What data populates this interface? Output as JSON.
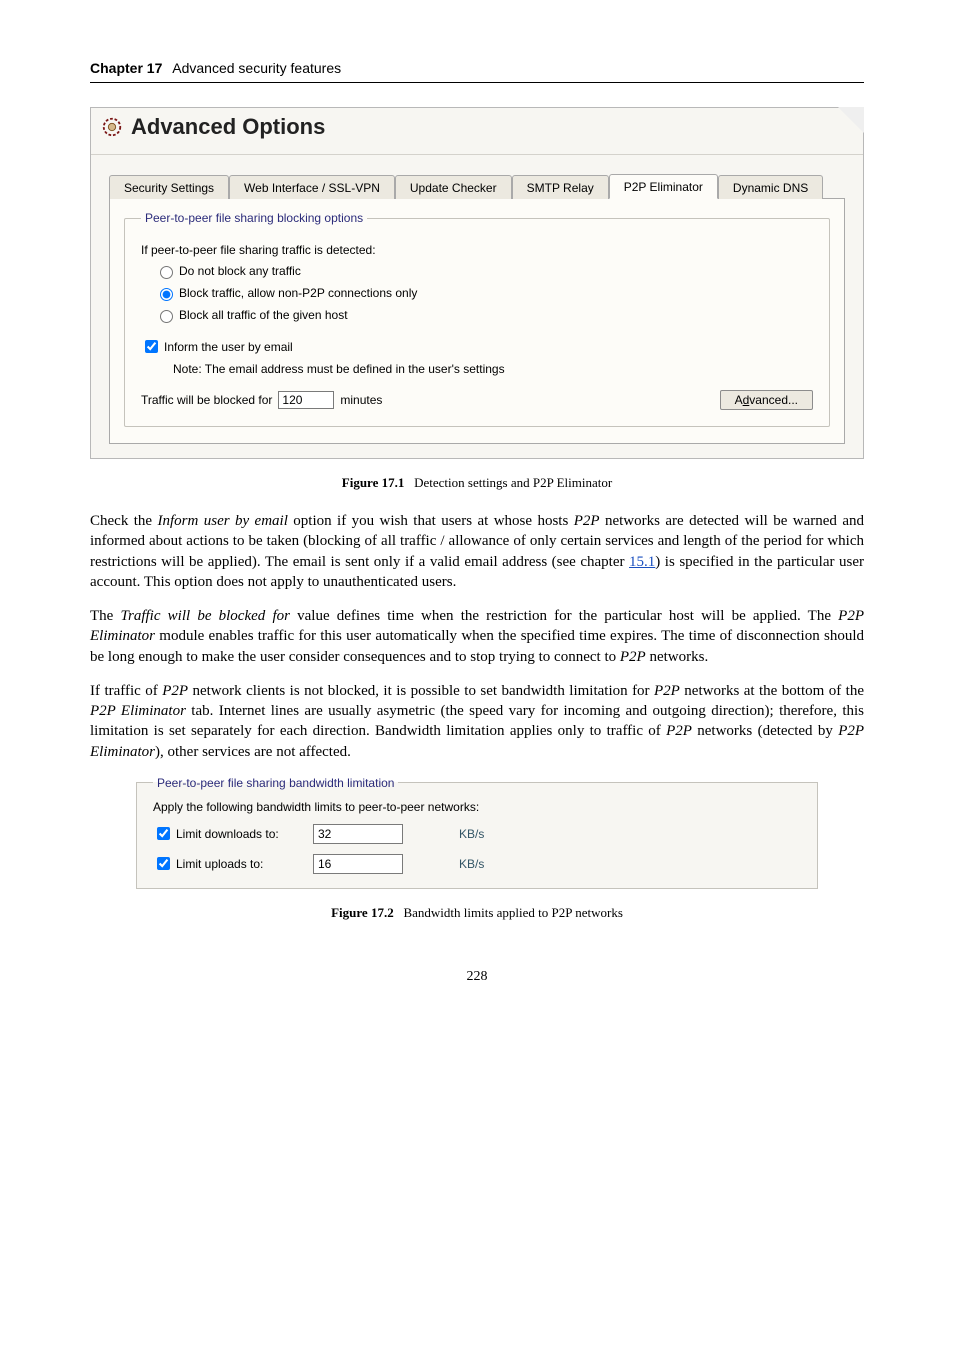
{
  "chapter": {
    "label": "Chapter 17",
    "title": "Advanced security features"
  },
  "panel": {
    "title": "Advanced Options",
    "tabs": {
      "security": "Security Settings",
      "web": "Web Interface / SSL-VPN",
      "update": "Update Checker",
      "smtp": "SMTP Relay",
      "p2p": "P2P Eliminator",
      "dns": "Dynamic DNS"
    },
    "group_legend": "Peer-to-peer file sharing blocking options",
    "detect_intro": "If peer-to-peer file sharing traffic is detected:",
    "opt_noblock": "Do not block any traffic",
    "opt_blocknonp2p": "Block traffic, allow non-P2P connections only",
    "opt_blockall": "Block all traffic of the given host",
    "inform_label": "Inform the user by email",
    "inform_note": "Note: The email address must be defined in the user's settings",
    "traffic_label_pre": "Traffic will be blocked for",
    "traffic_value": "120",
    "traffic_label_post": "minutes",
    "advanced_btn_pre": "A",
    "advanced_btn_accel": "d",
    "advanced_btn_post": "vanced..."
  },
  "fig1": {
    "label": "Figure 17.1",
    "caption": "Detection settings and P2P Eliminator"
  },
  "para1_a": "Check the ",
  "para1_em1": "Inform user by email",
  "para1_b": " option if you wish that users at whose hosts ",
  "para1_em2": "P2P",
  "para1_c": " networks are detected will be warned and informed about actions to be taken (blocking of all traffic / allowance of only certain services and length of the period for which restrictions will be applied). The email is sent only if a valid email address (see chapter ",
  "para1_link": "15.1",
  "para1_d": ") is specified in the particular user account. This option does not apply to unauthenticated users.",
  "para2_a": "The ",
  "para2_em1": "Traffic will be blocked for",
  "para2_b": " value defines time when the restriction for the particular host will be applied. The ",
  "para2_em2": "P2P Eliminator",
  "para2_c": " module enables traffic for this user automatically when the specified time expires. The time of disconnection should be long enough to make the user consider consequences and to stop trying to connect to ",
  "para2_em3": "P2P",
  "para2_d": " networks.",
  "para3_a": "If traffic of ",
  "para3_em1": "P2P",
  "para3_b": " network clients is not blocked, it is possible to set bandwidth limitation for ",
  "para3_em2": "P2P",
  "para3_c": " networks at the bottom of the ",
  "para3_em3": "P2P Eliminator",
  "para3_d": " tab. Internet lines are usually asymetric (the speed vary for incoming and outgoing direction); therefore, this limitation is set separately for each direction. Bandwidth limitation applies only to traffic of ",
  "para3_em4": "P2P",
  "para3_e": " networks (detected by ",
  "para3_em5": "P2P Eliminator",
  "para3_f": "), other services are not affected.",
  "bw": {
    "legend": "Peer-to-peer file sharing bandwidth limitation",
    "intro": "Apply the following bandwidth limits to peer-to-peer networks:",
    "dl_label": "Limit downloads to:",
    "dl_value": "32",
    "ul_label": "Limit uploads to:",
    "ul_value": "16",
    "unit": "KB/s"
  },
  "fig2": {
    "label": "Figure 17.2",
    "caption": "Bandwidth limits applied to P2P networks"
  },
  "pagenum": "228"
}
